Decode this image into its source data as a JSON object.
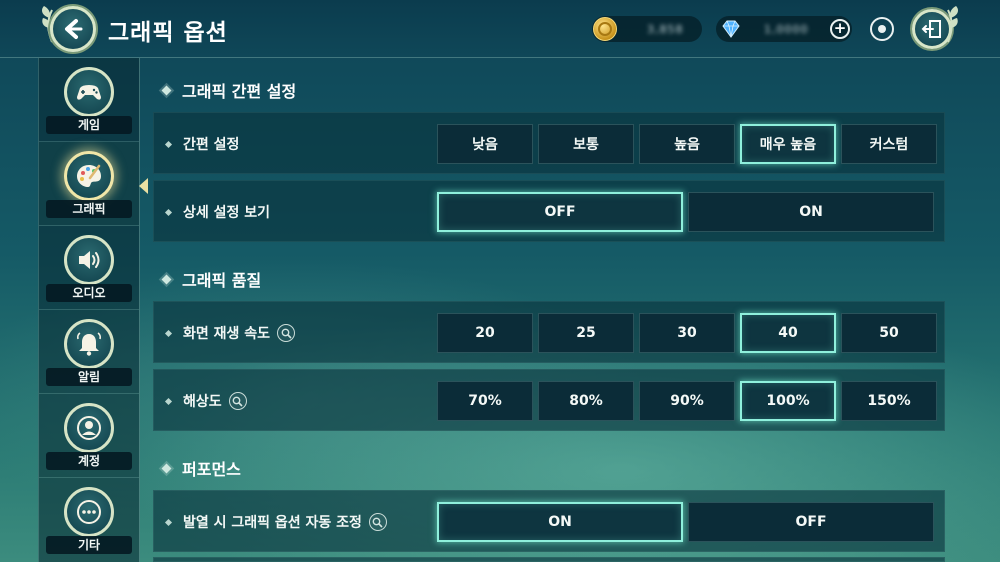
{
  "header": {
    "title": "그래픽 옵션",
    "gold_amount": "3,858",
    "gem_amount": "1,0000"
  },
  "sidebar": {
    "items": [
      {
        "label": "게임",
        "icon": "gamepad-icon"
      },
      {
        "label": "그래픽",
        "icon": "palette-icon",
        "active": true
      },
      {
        "label": "오디오",
        "icon": "speaker-icon"
      },
      {
        "label": "알림",
        "icon": "bell-icon"
      },
      {
        "label": "계정",
        "icon": "user-icon"
      },
      {
        "label": "기타",
        "icon": "more-icon"
      }
    ]
  },
  "sections": {
    "quick": {
      "title": "그래픽 간편 설정",
      "preset": {
        "label": "간편 설정",
        "options": [
          "낮음",
          "보통",
          "높음",
          "매우 높음",
          "커스텀"
        ],
        "selected": "매우 높음"
      },
      "detail": {
        "label": "상세 설정 보기",
        "options": [
          "OFF",
          "ON"
        ],
        "selected": "OFF"
      }
    },
    "quality": {
      "title": "그래픽 품질",
      "framerate": {
        "label": "화면 재생 속도",
        "options": [
          "20",
          "25",
          "30",
          "40",
          "50"
        ],
        "selected": "40"
      },
      "resolution": {
        "label": "해상도",
        "options": [
          "70%",
          "80%",
          "90%",
          "100%",
          "150%"
        ],
        "selected": "100%"
      }
    },
    "performance": {
      "title": "퍼포먼스",
      "auto_adjust": {
        "label": "발열 시 그래픽 옵션 자동 조정",
        "options": [
          "ON",
          "OFF"
        ],
        "selected": "ON"
      }
    }
  },
  "colors": {
    "accent": "#8ff0dc",
    "active_tab_glow": "#f0e6a8",
    "panel": "#0a343e"
  }
}
